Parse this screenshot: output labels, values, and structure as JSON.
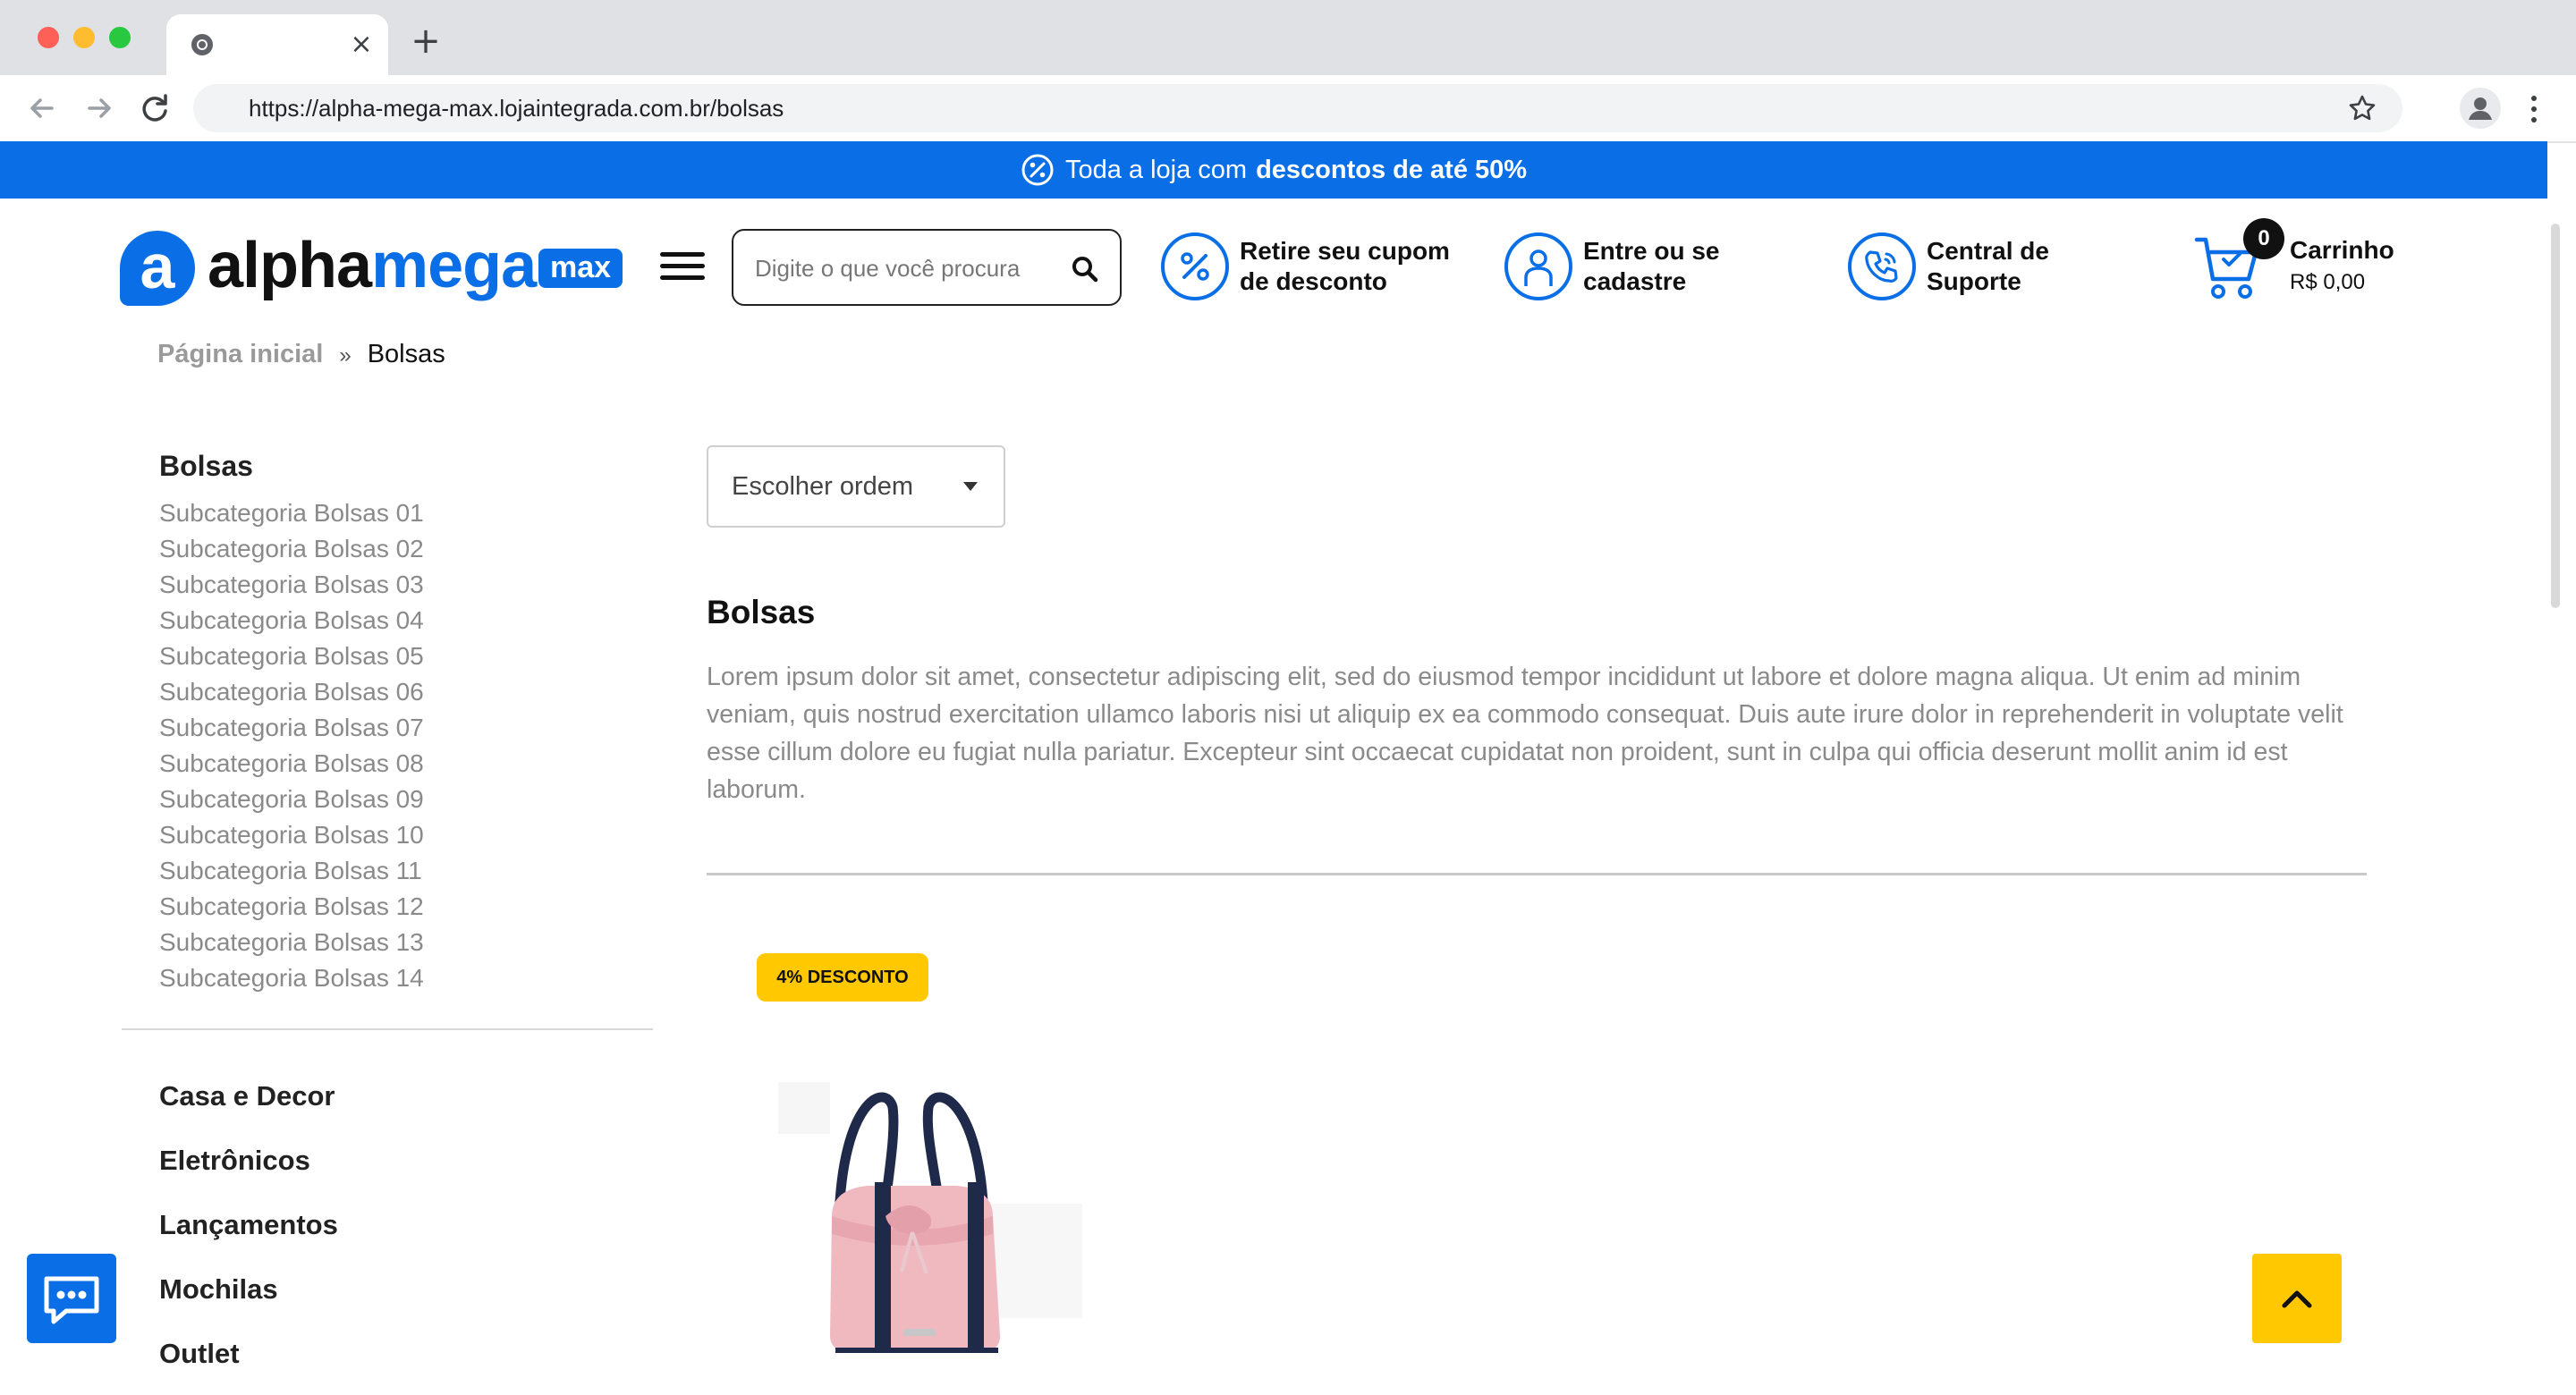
{
  "browser": {
    "url": "https://alpha-mega-max.lojaintegrada.com.br/bolsas",
    "tab_close": "×",
    "new_tab": "+"
  },
  "promo": {
    "text": "Toda a loja com",
    "highlight": "descontos de até 50%"
  },
  "header": {
    "logo": {
      "alpha": "alpha",
      "mega": "mega",
      "max": "max",
      "mark": "a"
    },
    "search_placeholder": "Digite o que você procura",
    "coupon": {
      "line1": "Retire seu cupom",
      "line2": "de desconto"
    },
    "account": {
      "line1": "Entre ou se",
      "line2": "cadastre"
    },
    "support": {
      "line1": "Central de",
      "line2": "Suporte"
    },
    "cart": {
      "count": "0",
      "title": "Carrinho",
      "total": "R$ 0,00"
    }
  },
  "breadcrumb": {
    "home": "Página inicial",
    "separator": "»",
    "current": "Bolsas"
  },
  "sidebar": {
    "title": "Bolsas",
    "subcategories": [
      "Subcategoria Bolsas 01",
      "Subcategoria Bolsas 02",
      "Subcategoria Bolsas 03",
      "Subcategoria Bolsas 04",
      "Subcategoria Bolsas 05",
      "Subcategoria Bolsas 06",
      "Subcategoria Bolsas 07",
      "Subcategoria Bolsas 08",
      "Subcategoria Bolsas 09",
      "Subcategoria Bolsas 10",
      "Subcategoria Bolsas 11",
      "Subcategoria Bolsas 12",
      "Subcategoria Bolsas 13",
      "Subcategoria Bolsas 14"
    ],
    "categories": [
      "Casa e Decor",
      "Eletrônicos",
      "Lançamentos",
      "Mochilas",
      "Outlet"
    ]
  },
  "main": {
    "sort_label": "Escolher ordem",
    "heading": "Bolsas",
    "description": "Lorem ipsum dolor sit amet, consectetur adipiscing elit, sed do eiusmod tempor incididunt ut labore et dolore magna aliqua. Ut enim ad minim veniam, quis nostrud exercitation ullamco laboris nisi ut aliquip ex ea commodo consequat. Duis aute irure dolor in reprehenderit in voluptate velit esse cillum dolore eu fugiat nulla pariatur. Excepteur sint occaecat cupidatat non proident, sunt in culpa qui officia deserunt mollit anim id est laborum.",
    "product": {
      "badge": "4% DESCONTO",
      "image_icon": "tote-bag-image"
    }
  },
  "colors": {
    "brand_blue": "#0a6fe6",
    "accent_yellow": "#ffc800",
    "text_dark": "#111111",
    "text_muted": "#8a8a8a"
  },
  "icons": {
    "promo": "percent-circle-icon",
    "coupon": "percent-circle-icon",
    "account": "user-icon",
    "support": "phone-icon",
    "cart": "cart-icon",
    "search": "search-icon",
    "chat": "chat-bubble-icon",
    "back_top": "chevron-up-icon"
  }
}
